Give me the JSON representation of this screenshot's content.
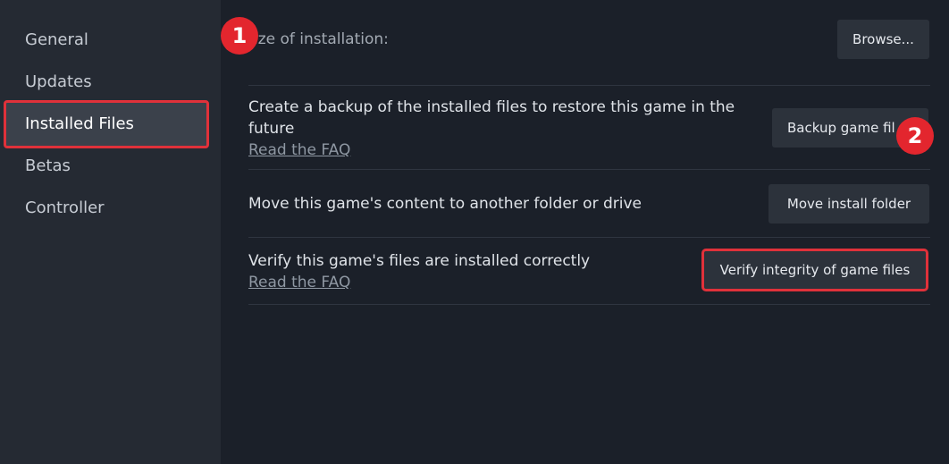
{
  "sidebar": {
    "items": [
      {
        "label": "General"
      },
      {
        "label": "Updates"
      },
      {
        "label": "Installed Files"
      },
      {
        "label": "Betas"
      },
      {
        "label": "Controller"
      }
    ],
    "active_index": 2
  },
  "main": {
    "size_row": {
      "label": "ize of installation:",
      "button": "Browse..."
    },
    "backup_row": {
      "text": "Create a backup of the installed files to restore this game in the future",
      "link": "Read the FAQ",
      "button": "Backup game fil"
    },
    "move_row": {
      "text": "Move this game's content to another folder or drive",
      "button": "Move install folder"
    },
    "verify_row": {
      "text": "Verify this game's files are installed correctly",
      "link": "Read the FAQ",
      "button": "Verify integrity of game files"
    }
  },
  "annotations": {
    "badge_1": "1",
    "badge_2": "2",
    "highlight_color": "#e0313a"
  }
}
